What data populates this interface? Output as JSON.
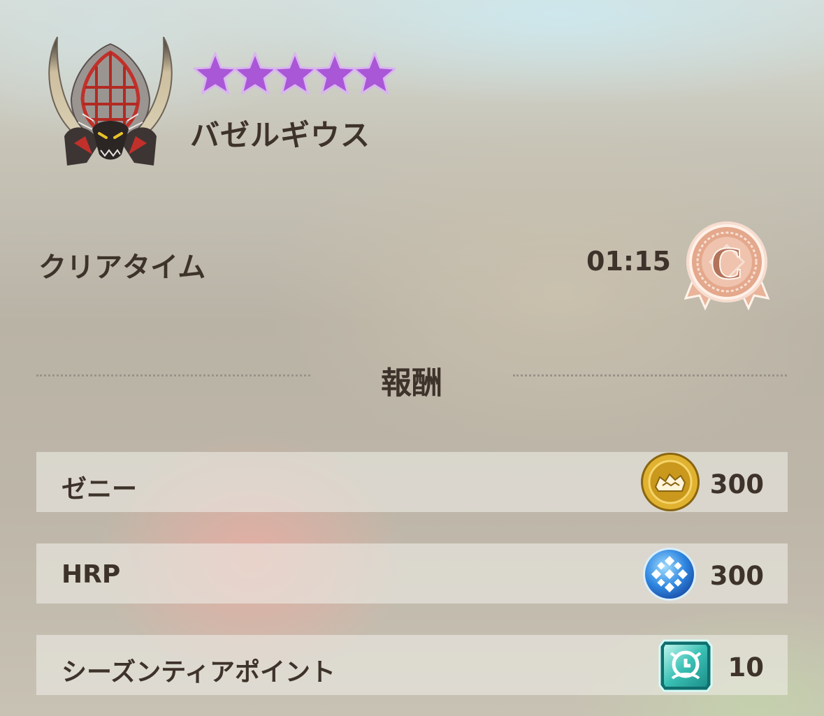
{
  "monster": {
    "name": "バゼルギウス",
    "star_count": 5,
    "star_color": "#a957d6",
    "icon": "bazelgeuse-monster-icon"
  },
  "clear": {
    "label": "クリアタイム",
    "time": "01:15",
    "rank": "C",
    "rank_icon": "bronze-rank-medal-icon"
  },
  "rewards": {
    "heading": "報酬",
    "items": [
      {
        "label": "ゼニー",
        "value": "300",
        "icon": "zenny-coin-icon"
      },
      {
        "label": "HRP",
        "value": "300",
        "icon": "hrp-orb-icon"
      },
      {
        "label": "シーズンティアポイント",
        "value": "10",
        "icon": "season-tier-point-icon"
      }
    ]
  }
}
